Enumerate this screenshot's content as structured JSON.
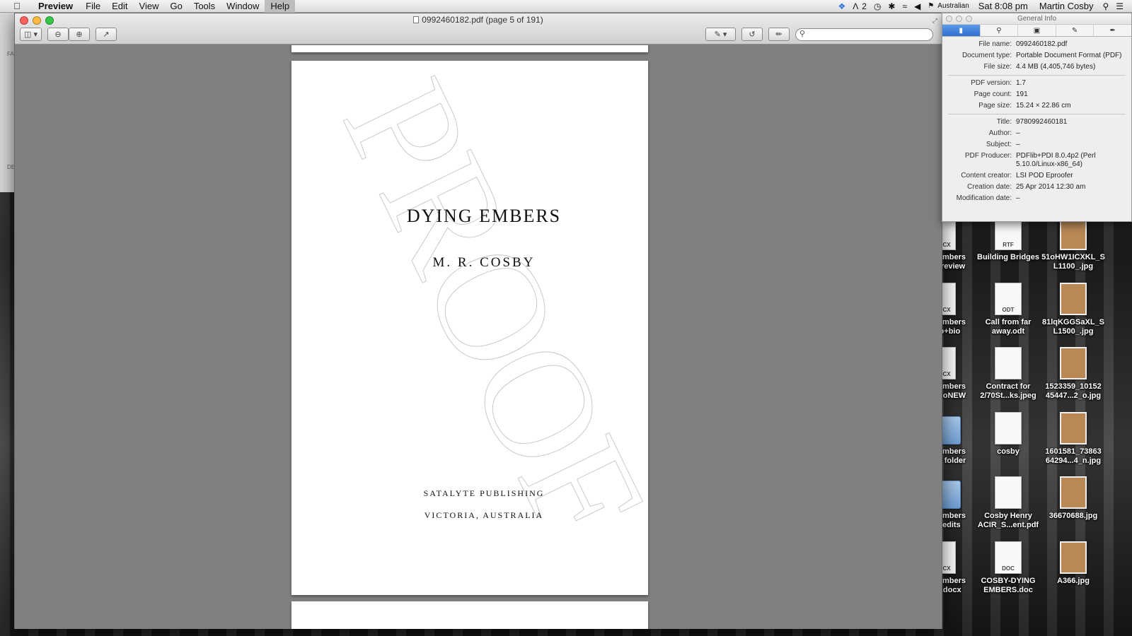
{
  "menubar": {
    "app_name": "Preview",
    "menus": [
      "File",
      "Edit",
      "View",
      "Go",
      "Tools",
      "Window",
      "Help"
    ],
    "active_menu": "Help",
    "status": {
      "notification_count": "2",
      "input_source": "Australian",
      "time": "Sat 8:08 pm",
      "user": "Martin Cosby"
    }
  },
  "window": {
    "title": "0992460182.pdf (page 5 of 191)",
    "search": {
      "value": "",
      "placeholder": ""
    }
  },
  "page": {
    "watermark": "PROOF",
    "title": "DYING EMBERS",
    "author": "M. R. COSBY",
    "publisher": "SATALYTE PUBLISHING",
    "location": "VICTORIA, AUSTRALIA"
  },
  "background_window": {
    "labels": [
      "FA",
      "DE"
    ]
  },
  "inspector": {
    "title": "General Info",
    "tabs": [
      "general-info-icon",
      "search-icon",
      "lock-icon",
      "pencil-icon",
      "pen-icon"
    ],
    "groups": [
      [
        {
          "label": "File name:",
          "value": "0992460182.pdf"
        },
        {
          "label": "Document type:",
          "value": "Portable Document Format (PDF)"
        },
        {
          "label": "File size:",
          "value": "4.4 MB (4,405,746 bytes)"
        }
      ],
      [
        {
          "label": "PDF version:",
          "value": "1.7"
        },
        {
          "label": "Page count:",
          "value": "191"
        },
        {
          "label": "Page size:",
          "value": "15.24 × 22.86 cm"
        }
      ],
      [
        {
          "label": "Title:",
          "value": "9780992460181"
        },
        {
          "label": "Author:",
          "value": "–"
        },
        {
          "label": "Subject:",
          "value": "–"
        },
        {
          "label": "PDF Producer:",
          "value": "PDFlib+PDI 8.0.4p2 (Perl 5.10.0/Linux-x86_64)"
        },
        {
          "label": "Content creator:",
          "value": "LSI POD Eproofer"
        },
        {
          "label": "Creation date:",
          "value": "25 Apr 2014 12:30 am"
        },
        {
          "label": "Modification date:",
          "value": "–"
        }
      ]
    ]
  },
  "desktop": {
    "icons": [
      {
        "label": "ying Embers\nurb + review",
        "ext": "DOCX",
        "kind": "doc"
      },
      {
        "label": "Building Bridges",
        "ext": "RTF",
        "kind": "doc"
      },
      {
        "label": "51oHW1ICXKL_S\nL1100_.jpg",
        "ext": "",
        "kind": "photo"
      },
      {
        "label": "ying Embers\nblurb+bio",
        "ext": "DOCX",
        "kind": "doc"
      },
      {
        "label": "Call from far\naway.odt",
        "ext": "ODT",
        "kind": "doc"
      },
      {
        "label": "81lqKGGSaXL_S\nL1500_.jpg",
        "ext": "",
        "kind": "photo"
      },
      {
        "label": "ying Embers\nurb+bioNEW",
        "ext": "DOCX",
        "kind": "doc"
      },
      {
        "label": "Contract for\n2/70St...ks.jpeg",
        "ext": "",
        "kind": "doc"
      },
      {
        "label": "1523359_10152\n45447...2_o.jpg",
        "ext": "",
        "kind": "photo"
      },
      {
        "label": "ying Embers\nook...r folder",
        "ext": "",
        "kind": "folder"
      },
      {
        "label": "cosby",
        "ext": "",
        "kind": "doc"
      },
      {
        "label": "1601581_73863\n64294...4_n.jpg",
        "ext": "",
        "kind": "photo"
      },
      {
        "label": "ying Embers\nfinal edits",
        "ext": "",
        "kind": "folder"
      },
      {
        "label": "Cosby Henry\nACIR_S...ent.pdf",
        "ext": "",
        "kind": "doc"
      },
      {
        "label": "36670688.jpg",
        "ext": "",
        "kind": "photo"
      },
      {
        "label": "ying Embers\nIntro.docx",
        "ext": "DOCX",
        "kind": "doc"
      },
      {
        "label": "COSBY-DYING\nEMBERS.doc",
        "ext": "DOC",
        "kind": "doc"
      },
      {
        "label": "A366.jpg",
        "ext": "",
        "kind": "photo"
      }
    ]
  }
}
